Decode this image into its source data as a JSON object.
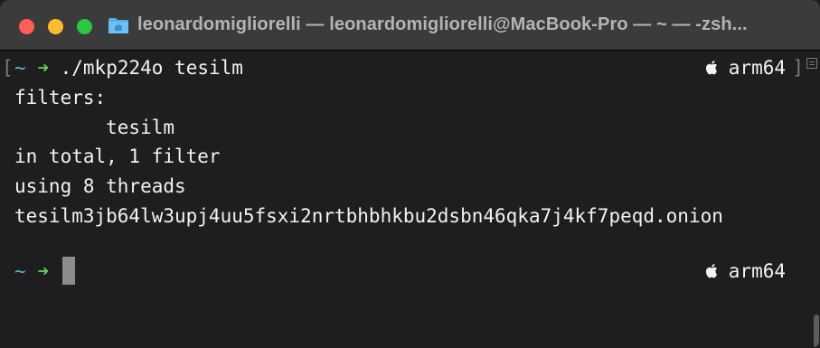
{
  "window": {
    "title": "leonardomigliorelli — leonardomigliorelli@MacBook-Pro — ~ — -zsh..."
  },
  "icons": {
    "close": "close-button",
    "minimize": "minimize-button",
    "maximize": "zoom-button",
    "folder": "folder-icon",
    "apple": "apple-icon",
    "prompt_arrow": "arrow-right-icon"
  },
  "prompt": {
    "tilde": "~",
    "arrow": "➜",
    "arch": "arm64"
  },
  "lines": {
    "command": "./mkp224o tesilm",
    "filters_header": "filters:",
    "filter_item": "        tesilm",
    "total": "in total, 1 filter",
    "threads": "using 8 threads",
    "onion": "tesilm3jb64lw3upj4uu5fsxi2nrtbhbhkbu2dsbn46qka7j4kf7peqd.onion"
  },
  "colors": {
    "tilde": "#4fb6d6",
    "arrow": "#5ad155",
    "text": "#f2f2f2",
    "background": "#1e1e1e",
    "titlebar": "#3b3b3b"
  }
}
